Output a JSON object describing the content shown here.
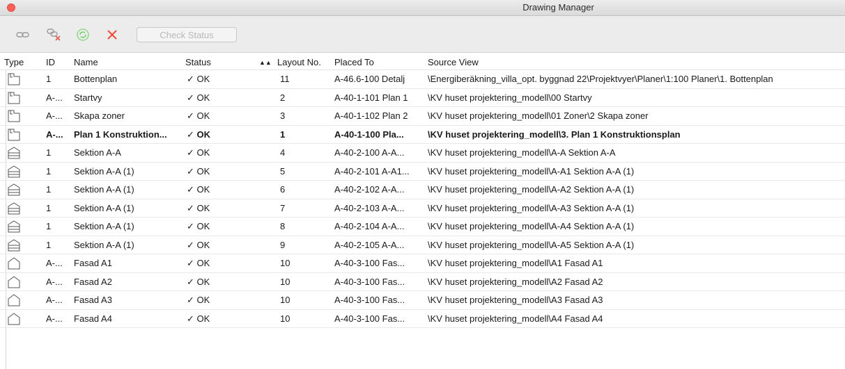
{
  "window": {
    "title": "Drawing Manager"
  },
  "toolbar": {
    "check_status_label": "Check Status",
    "icons": [
      "link-icon",
      "unlink-icon",
      "refresh-icon",
      "delete-icon"
    ]
  },
  "columns": {
    "type": "Type",
    "id": "ID",
    "name": "Name",
    "status": "Status",
    "layout_sort": "▲▲",
    "layout": "Layout No.",
    "placed": "Placed To",
    "source": "Source View"
  },
  "rows": [
    {
      "type": "plan",
      "id": "1",
      "name": "Bottenplan",
      "status": "✓ OK",
      "layout": "11",
      "placed": "A-46.6-100 Detalj",
      "source": "\\Energiberäkning_villa_opt. byggnad 22\\Projektvyer\\Planer\\1:100 Planer\\1. Bottenplan",
      "bold": false
    },
    {
      "type": "plan",
      "id": "A-...",
      "name": "Startvy",
      "status": "✓ OK",
      "layout": "2",
      "placed": "A-40-1-101 Plan 1",
      "source": "\\KV huset projektering_modell\\00 Startvy",
      "bold": false
    },
    {
      "type": "plan",
      "id": "A-...",
      "name": "Skapa zoner",
      "status": "✓ OK",
      "layout": "3",
      "placed": "A-40-1-102 Plan 2",
      "source": "\\KV huset projektering_modell\\01 Zoner\\2 Skapa zoner",
      "bold": false
    },
    {
      "type": "plan",
      "id": "A-...",
      "name": "Plan 1 Konstruktion...",
      "status": "✓ OK",
      "layout": "1",
      "placed": "A-40-1-100 Pla...",
      "source": "\\KV huset projektering_modell\\3. Plan 1 Konstruktionsplan",
      "bold": true
    },
    {
      "type": "section",
      "id": "1",
      "name": "Sektion A-A",
      "status": "✓ OK",
      "layout": "4",
      "placed": "A-40-2-100 A-A...",
      "source": "\\KV huset projektering_modell\\A-A Sektion A-A",
      "bold": false
    },
    {
      "type": "section",
      "id": "1",
      "name": "Sektion A-A (1)",
      "status": "✓ OK",
      "layout": "5",
      "placed": "A-40-2-101 A-A1...",
      "source": "\\KV huset projektering_modell\\A-A1 Sektion A-A (1)",
      "bold": false
    },
    {
      "type": "section",
      "id": "1",
      "name": "Sektion A-A (1)",
      "status": "✓ OK",
      "layout": "6",
      "placed": "A-40-2-102 A-A...",
      "source": "\\KV huset projektering_modell\\A-A2 Sektion A-A (1)",
      "bold": false
    },
    {
      "type": "section",
      "id": "1",
      "name": "Sektion A-A (1)",
      "status": "✓ OK",
      "layout": "7",
      "placed": "A-40-2-103 A-A...",
      "source": "\\KV huset projektering_modell\\A-A3 Sektion A-A (1)",
      "bold": false
    },
    {
      "type": "section",
      "id": "1",
      "name": "Sektion A-A (1)",
      "status": "✓ OK",
      "layout": "8",
      "placed": "A-40-2-104 A-A...",
      "source": "\\KV huset projektering_modell\\A-A4 Sektion A-A (1)",
      "bold": false
    },
    {
      "type": "section",
      "id": "1",
      "name": "Sektion A-A (1)",
      "status": "✓ OK",
      "layout": "9",
      "placed": "A-40-2-105 A-A...",
      "source": "\\KV huset projektering_modell\\A-A5 Sektion A-A (1)",
      "bold": false
    },
    {
      "type": "elevation",
      "id": "A-...",
      "name": "Fasad A1",
      "status": "✓ OK",
      "layout": "10",
      "placed": "A-40-3-100 Fas...",
      "source": "\\KV huset projektering_modell\\A1 Fasad A1",
      "bold": false
    },
    {
      "type": "elevation",
      "id": "A-...",
      "name": "Fasad A2",
      "status": "✓ OK",
      "layout": "10",
      "placed": "A-40-3-100 Fas...",
      "source": "\\KV huset projektering_modell\\A2 Fasad A2",
      "bold": false
    },
    {
      "type": "elevation",
      "id": "A-...",
      "name": "Fasad A3",
      "status": "✓ OK",
      "layout": "10",
      "placed": "A-40-3-100 Fas...",
      "source": "\\KV huset projektering_modell\\A3 Fasad A3",
      "bold": false
    },
    {
      "type": "elevation",
      "id": "A-...",
      "name": "Fasad A4",
      "status": "✓ OK",
      "layout": "10",
      "placed": "A-40-3-100 Fas...",
      "source": "\\KV huset projektering_modell\\A4 Fasad A4",
      "bold": false
    }
  ],
  "colors": {
    "close": "#fd5f57",
    "delete": "#f04a3a",
    "refresh": "#6fcf6a"
  }
}
